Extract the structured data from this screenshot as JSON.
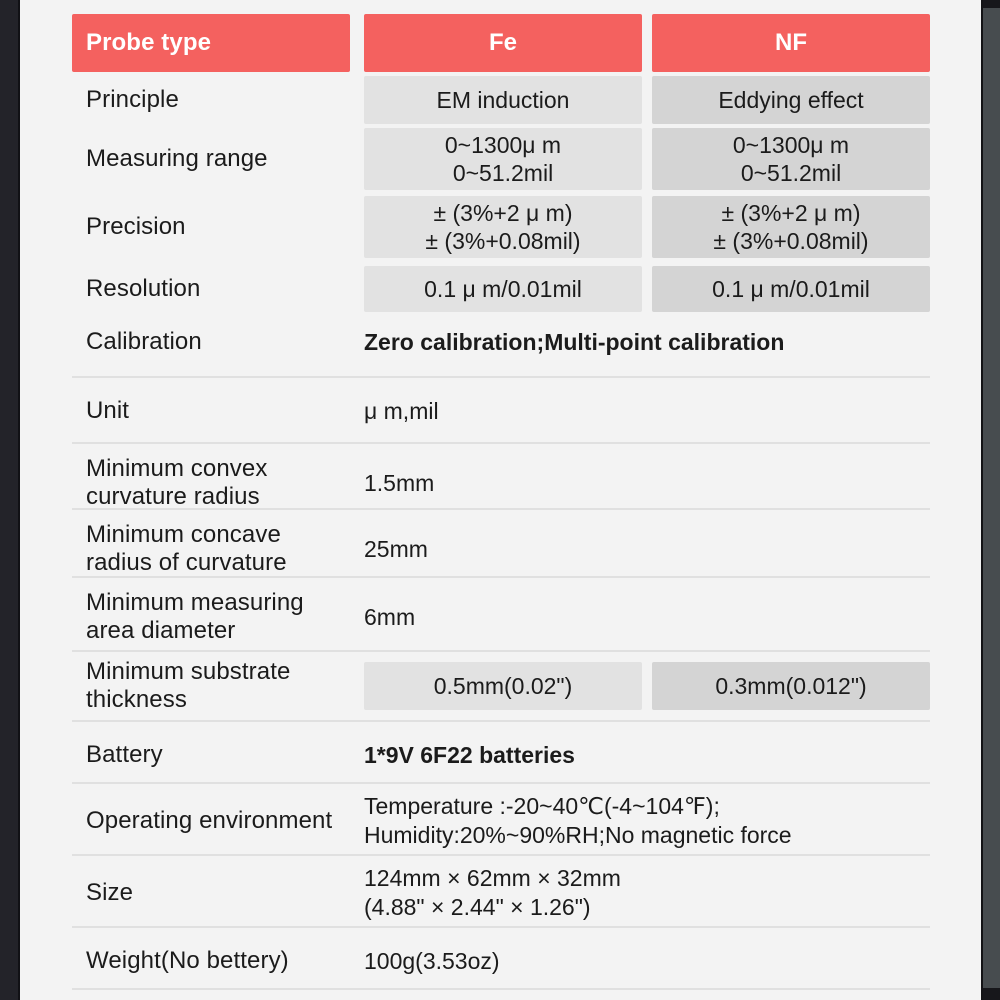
{
  "table": {
    "title_label": "Probe type",
    "columns": [
      "Probe type",
      "Fe",
      "NF"
    ],
    "header": {
      "label": "Probe type",
      "fe": "Fe",
      "nf": "NF",
      "bg_color": "#f4615f",
      "text_color": "#ffffff"
    },
    "colors": {
      "accent_red": "#f4615f",
      "fe_cell_bg": "#e2e2e2",
      "nf_cell_bg": "#d4d4d4",
      "page_bg": "#f3f3f3",
      "separator": "#e0e0e0",
      "text": "#1b1b1b",
      "frame_left": "#232329",
      "frame_right": "#474c4f"
    },
    "rows": [
      {
        "label": "Principle",
        "type": "split",
        "fe": [
          "EM induction"
        ],
        "nf": [
          "Eddying effect"
        ]
      },
      {
        "label": "Measuring range",
        "type": "split",
        "fe": [
          "0~1300μ m",
          "0~51.2mil"
        ],
        "nf": [
          "0~1300μ m",
          "0~51.2mil"
        ]
      },
      {
        "label": "Precision",
        "type": "split",
        "fe": [
          "± (3%+2 μ m)",
          "± (3%+0.08mil)"
        ],
        "nf": [
          "± (3%+2 μ m)",
          "± (3%+0.08mil)"
        ]
      },
      {
        "label": "Resolution",
        "type": "split",
        "fe": [
          "0.1 μ m/0.01mil"
        ],
        "nf": [
          "0.1 μ m/0.01mil"
        ]
      },
      {
        "label": "Calibration",
        "type": "merged",
        "bold": true,
        "value": [
          "Zero calibration;Multi-point calibration"
        ]
      },
      {
        "label": "Unit",
        "type": "merged",
        "bold": false,
        "value": [
          "μ m,mil"
        ]
      },
      {
        "label": "Minimum convex curvature radius",
        "type": "merged",
        "bold": false,
        "value": [
          "1.5mm"
        ]
      },
      {
        "label": "Minimum concave radius of curvature",
        "type": "merged",
        "bold": false,
        "value": [
          "25mm"
        ]
      },
      {
        "label": "Minimum measuring area diameter",
        "type": "merged",
        "bold": false,
        "value": [
          "6mm"
        ]
      },
      {
        "label": "Minimum substrate thickness",
        "type": "split",
        "fe": [
          "0.5mm(0.02\")"
        ],
        "nf": [
          "0.3mm(0.012\")"
        ]
      },
      {
        "label": "Battery",
        "type": "merged",
        "bold": true,
        "value": [
          "1*9V 6F22 batteries"
        ]
      },
      {
        "label": "Operating environment",
        "type": "merged",
        "bold": false,
        "value": [
          "Temperature :-20~40℃(-4~104℉);",
          "Humidity:20%~90%RH;No magnetic force"
        ]
      },
      {
        "label": "Size",
        "type": "merged",
        "bold": false,
        "value": [
          "124mm × 62mm × 32mm",
          "(4.88\" × 2.44\" × 1.26\")"
        ]
      },
      {
        "label": "Weight(No bettery)",
        "type": "merged",
        "bold": false,
        "value": [
          "100g(3.53oz)"
        ]
      }
    ]
  }
}
